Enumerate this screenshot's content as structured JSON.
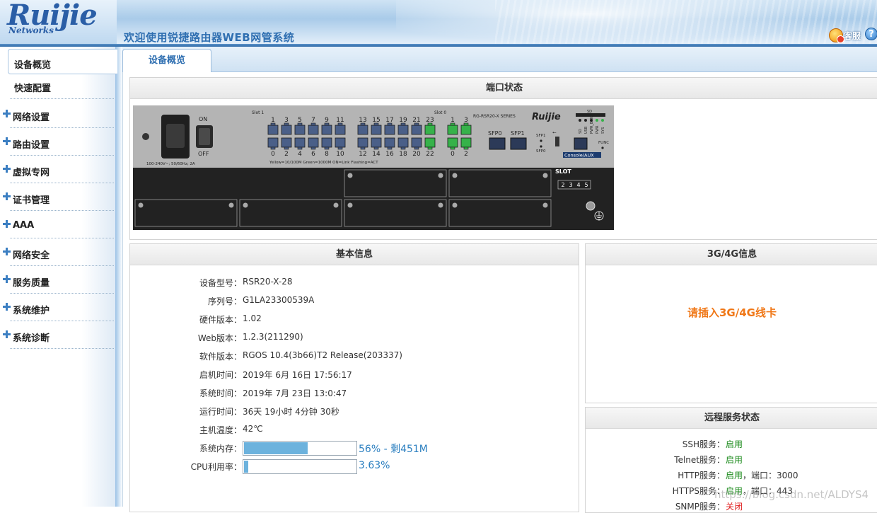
{
  "header": {
    "logo": "Ruijie",
    "logo_sub": "Networks",
    "welcome": "欢迎使用锐捷路由器WEB网管系统",
    "service_label": "客服",
    "help_label": "?"
  },
  "sidebar": {
    "items": [
      {
        "label": "设备概览",
        "active": true
      },
      {
        "label": "快速配置",
        "expandable": false
      },
      {
        "label": "网络设置",
        "expandable": true
      },
      {
        "label": "路由设置",
        "expandable": true
      },
      {
        "label": "虚拟专网",
        "expandable": true
      },
      {
        "label": "证书管理",
        "expandable": true
      },
      {
        "label": "AAA",
        "expandable": true
      },
      {
        "label": "网络安全",
        "expandable": true
      },
      {
        "label": "服务质量",
        "expandable": true
      },
      {
        "label": "系统维护",
        "expandable": true
      },
      {
        "label": "系统诊断",
        "expandable": true
      }
    ]
  },
  "tabs": [
    {
      "label": "设备概览",
      "active": true
    }
  ],
  "port_panel": {
    "title": "端口状态",
    "device": {
      "on_label": "ON",
      "off_label": "OFF",
      "power_rating": "100-240V~; 50/60Hz; 2A",
      "slot1": "Slot 1",
      "slot0": "Slot 0",
      "series": "RG-RSR20-X SERIES",
      "brand": "Ruijie",
      "top_ports": [
        "1",
        "3",
        "5",
        "7",
        "9",
        "11",
        "13",
        "15",
        "17",
        "19",
        "21",
        "23"
      ],
      "bottom_ports": [
        "0",
        "2",
        "4",
        "6",
        "8",
        "10",
        "12",
        "14",
        "16",
        "18",
        "20",
        "22"
      ],
      "slot0_top": [
        "1",
        "3"
      ],
      "slot0_bottom": [
        "0",
        "2"
      ],
      "legend": "Yellow=10/100M   Green=1000M   ON=Link   Flashing=ACT",
      "sfp0": "SFP0",
      "sfp1": "SFP1",
      "sfp_small_1": "SFP1",
      "sfp_small_0": "SFP0",
      "console": "Console/AUX",
      "leds": [
        "SD",
        "USB",
        "PWR_BAK",
        "PWR",
        "SYS"
      ],
      "led_top": "SD",
      "func": "FUNC",
      "slot_label": "SLOT",
      "slot_numbers": [
        "2",
        "3",
        "4",
        "5"
      ]
    }
  },
  "basic_info": {
    "title": "基本信息",
    "rows": [
      {
        "k": "设备型号：",
        "v": "RSR20-X-28"
      },
      {
        "k": "序列号：",
        "v": "G1LA23300539A"
      },
      {
        "k": "硬件版本：",
        "v": "1.02"
      },
      {
        "k": "Web版本：",
        "v": "1.2.3(211290)"
      },
      {
        "k": "软件版本：",
        "v": "RGOS 10.4(3b66)T2 Release(203337)"
      },
      {
        "k": "启机时间：",
        "v": "2019年 6月 16日 17:56:17"
      },
      {
        "k": "系统时间：",
        "v": "2019年 7月 23日 13:0:47"
      },
      {
        "k": "运行时间：",
        "v": "36天 19小时 4分钟 30秒"
      },
      {
        "k": "主机温度：",
        "v": "42℃"
      }
    ],
    "memory": {
      "k": "系统内存：",
      "percent": 56,
      "text": "56% - 剩451M"
    },
    "cpu": {
      "k": "CPU利用率：",
      "percent": 3.63,
      "text": "3.63%"
    }
  },
  "g34_info": {
    "title": "3G/4G信息",
    "message": "请插入3G/4G线卡"
  },
  "remote_services": {
    "title": "远程服务状态",
    "rows": [
      {
        "k": "SSH服务：",
        "status": "启用",
        "extra": ""
      },
      {
        "k": "Telnet服务：",
        "status": "启用",
        "extra": ""
      },
      {
        "k": "HTTP服务：",
        "status": "启用",
        "extra": "，端口：3000"
      },
      {
        "k": "HTTPS服务：",
        "status": "启用",
        "extra": "，端口：443"
      },
      {
        "k": "SNMP服务：",
        "status": "关闭",
        "extra": ""
      }
    ]
  },
  "watermark": "https://blog.csdn.net/ALDYS4",
  "colors": {
    "accent": "#2f6fb1",
    "enabled": "#1a8a1a",
    "disabled": "#e02020",
    "warning": "#f07818",
    "bar_fill": "#6cb2dd",
    "port_yellow": "#4a5f88",
    "port_green": "#36b24a"
  }
}
